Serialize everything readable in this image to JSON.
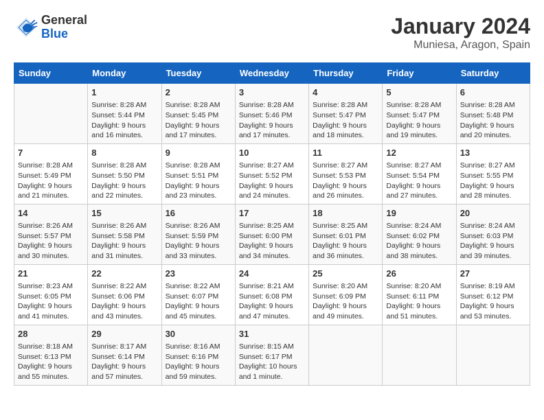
{
  "header": {
    "logo_general": "General",
    "logo_blue": "Blue",
    "month": "January 2024",
    "location": "Muniesa, Aragon, Spain"
  },
  "weekdays": [
    "Sunday",
    "Monday",
    "Tuesday",
    "Wednesday",
    "Thursday",
    "Friday",
    "Saturday"
  ],
  "weeks": [
    [
      {
        "day": "",
        "info": ""
      },
      {
        "day": "1",
        "info": "Sunrise: 8:28 AM\nSunset: 5:44 PM\nDaylight: 9 hours and 16 minutes."
      },
      {
        "day": "2",
        "info": "Sunrise: 8:28 AM\nSunset: 5:45 PM\nDaylight: 9 hours and 17 minutes."
      },
      {
        "day": "3",
        "info": "Sunrise: 8:28 AM\nSunset: 5:46 PM\nDaylight: 9 hours and 17 minutes."
      },
      {
        "day": "4",
        "info": "Sunrise: 8:28 AM\nSunset: 5:47 PM\nDaylight: 9 hours and 18 minutes."
      },
      {
        "day": "5",
        "info": "Sunrise: 8:28 AM\nSunset: 5:47 PM\nDaylight: 9 hours and 19 minutes."
      },
      {
        "day": "6",
        "info": "Sunrise: 8:28 AM\nSunset: 5:48 PM\nDaylight: 9 hours and 20 minutes."
      }
    ],
    [
      {
        "day": "7",
        "info": "Sunrise: 8:28 AM\nSunset: 5:49 PM\nDaylight: 9 hours and 21 minutes."
      },
      {
        "day": "8",
        "info": "Sunrise: 8:28 AM\nSunset: 5:50 PM\nDaylight: 9 hours and 22 minutes."
      },
      {
        "day": "9",
        "info": "Sunrise: 8:28 AM\nSunset: 5:51 PM\nDaylight: 9 hours and 23 minutes."
      },
      {
        "day": "10",
        "info": "Sunrise: 8:27 AM\nSunset: 5:52 PM\nDaylight: 9 hours and 24 minutes."
      },
      {
        "day": "11",
        "info": "Sunrise: 8:27 AM\nSunset: 5:53 PM\nDaylight: 9 hours and 26 minutes."
      },
      {
        "day": "12",
        "info": "Sunrise: 8:27 AM\nSunset: 5:54 PM\nDaylight: 9 hours and 27 minutes."
      },
      {
        "day": "13",
        "info": "Sunrise: 8:27 AM\nSunset: 5:55 PM\nDaylight: 9 hours and 28 minutes."
      }
    ],
    [
      {
        "day": "14",
        "info": "Sunrise: 8:26 AM\nSunset: 5:57 PM\nDaylight: 9 hours and 30 minutes."
      },
      {
        "day": "15",
        "info": "Sunrise: 8:26 AM\nSunset: 5:58 PM\nDaylight: 9 hours and 31 minutes."
      },
      {
        "day": "16",
        "info": "Sunrise: 8:26 AM\nSunset: 5:59 PM\nDaylight: 9 hours and 33 minutes."
      },
      {
        "day": "17",
        "info": "Sunrise: 8:25 AM\nSunset: 6:00 PM\nDaylight: 9 hours and 34 minutes."
      },
      {
        "day": "18",
        "info": "Sunrise: 8:25 AM\nSunset: 6:01 PM\nDaylight: 9 hours and 36 minutes."
      },
      {
        "day": "19",
        "info": "Sunrise: 8:24 AM\nSunset: 6:02 PM\nDaylight: 9 hours and 38 minutes."
      },
      {
        "day": "20",
        "info": "Sunrise: 8:24 AM\nSunset: 6:03 PM\nDaylight: 9 hours and 39 minutes."
      }
    ],
    [
      {
        "day": "21",
        "info": "Sunrise: 8:23 AM\nSunset: 6:05 PM\nDaylight: 9 hours and 41 minutes."
      },
      {
        "day": "22",
        "info": "Sunrise: 8:22 AM\nSunset: 6:06 PM\nDaylight: 9 hours and 43 minutes."
      },
      {
        "day": "23",
        "info": "Sunrise: 8:22 AM\nSunset: 6:07 PM\nDaylight: 9 hours and 45 minutes."
      },
      {
        "day": "24",
        "info": "Sunrise: 8:21 AM\nSunset: 6:08 PM\nDaylight: 9 hours and 47 minutes."
      },
      {
        "day": "25",
        "info": "Sunrise: 8:20 AM\nSunset: 6:09 PM\nDaylight: 9 hours and 49 minutes."
      },
      {
        "day": "26",
        "info": "Sunrise: 8:20 AM\nSunset: 6:11 PM\nDaylight: 9 hours and 51 minutes."
      },
      {
        "day": "27",
        "info": "Sunrise: 8:19 AM\nSunset: 6:12 PM\nDaylight: 9 hours and 53 minutes."
      }
    ],
    [
      {
        "day": "28",
        "info": "Sunrise: 8:18 AM\nSunset: 6:13 PM\nDaylight: 9 hours and 55 minutes."
      },
      {
        "day": "29",
        "info": "Sunrise: 8:17 AM\nSunset: 6:14 PM\nDaylight: 9 hours and 57 minutes."
      },
      {
        "day": "30",
        "info": "Sunrise: 8:16 AM\nSunset: 6:16 PM\nDaylight: 9 hours and 59 minutes."
      },
      {
        "day": "31",
        "info": "Sunrise: 8:15 AM\nSunset: 6:17 PM\nDaylight: 10 hours and 1 minute."
      },
      {
        "day": "",
        "info": ""
      },
      {
        "day": "",
        "info": ""
      },
      {
        "day": "",
        "info": ""
      }
    ]
  ]
}
